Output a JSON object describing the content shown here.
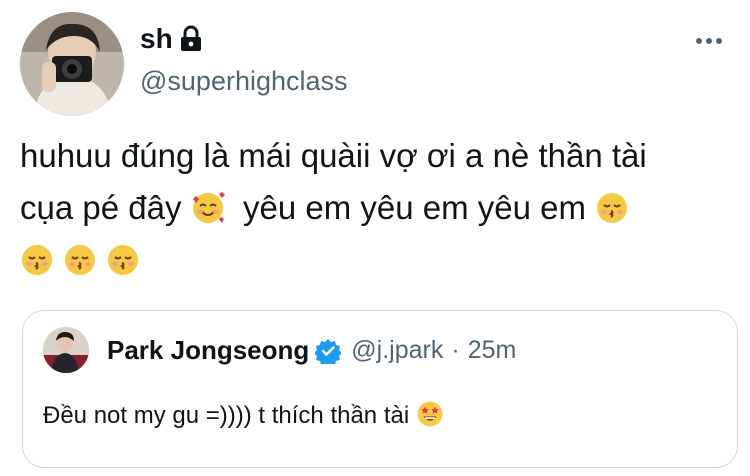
{
  "tweet": {
    "author_name": "sh",
    "author_handle": "@superhighclass",
    "text_line1": "huhuu đúng là mái quàii vợ ơi a nè thần tài",
    "text_line2a": "cụa pé đây ",
    "text_line2b": "  yêu em yêu em yêu em ",
    "icons": {
      "lock": "lock-icon",
      "more": "more-options-icon",
      "emoji_hearts": "smiling-face-with-hearts-icon",
      "emoji_kiss": "kissing-face-closed-eyes-icon"
    }
  },
  "quote": {
    "author_name": "Park Jongseong",
    "author_handle": "@j.jpark",
    "separator": "·",
    "time": "25m",
    "text": "Đều not my gu =)))) t thích thần tài ",
    "icons": {
      "verified": "verified-badge-icon",
      "emoji_star": "star-struck-icon"
    }
  },
  "colors": {
    "text_primary": "#0f1419",
    "text_secondary": "#536471",
    "border": "#cfd9de",
    "verified": "#1d9bf0"
  }
}
